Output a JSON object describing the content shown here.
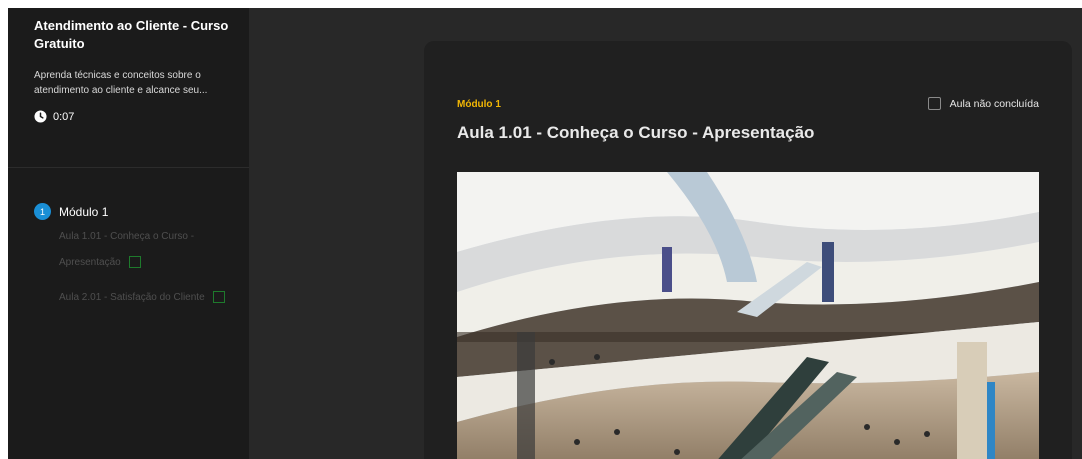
{
  "course": {
    "title": "Atendimento ao Cliente - Curso Gratuito",
    "description": "Aprenda técnicas e conceitos sobre o atendimento ao cliente e alcance seu...",
    "duration": "0:07"
  },
  "sidebar": {
    "module": {
      "number": "1",
      "label": "Módulo 1"
    },
    "lessons": [
      {
        "label": "Aula 1.01 - Conheça o Curso - Apresentação"
      },
      {
        "label": "Aula 2.01 - Satisfação do Cliente"
      }
    ]
  },
  "main": {
    "module_tag": "Módulo 1",
    "completion_label": "Aula não concluída",
    "lesson_title": "Aula 1.01 - Conheça o Curso - Apresentação"
  },
  "colors": {
    "accent_blue": "#1a8fd6",
    "accent_yellow": "#f2b705",
    "check_green": "#1e7a2c"
  },
  "icons": {
    "duration": "clock-icon"
  }
}
